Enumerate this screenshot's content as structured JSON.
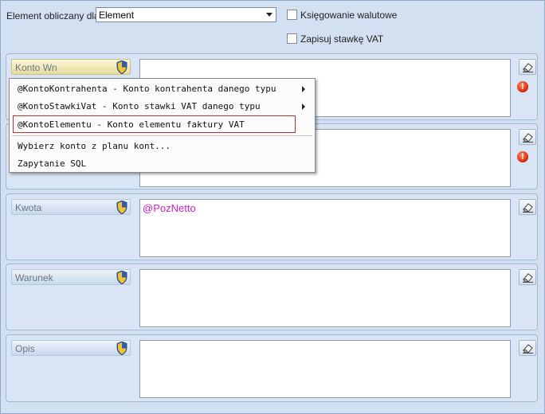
{
  "top": {
    "element_label": "Element obliczany dla:",
    "element_value": "Element",
    "checkbox_currency": "Księgowanie walutowe",
    "checkbox_vat": "Zapisuj stawkę VAT"
  },
  "sections": [
    {
      "key": "konto_wn",
      "label": "Konto Wn",
      "value": ""
    },
    {
      "key": "konto_ma",
      "label": "",
      "value": ""
    },
    {
      "key": "kwota",
      "label": "Kwota",
      "value": "@PozNetto"
    },
    {
      "key": "warunek",
      "label": "Warunek",
      "value": ""
    },
    {
      "key": "opis",
      "label": "Opis",
      "value": ""
    }
  ],
  "context_menu": {
    "items": [
      {
        "label": "@KontoKontrahenta - Konto kontrahenta danego typu",
        "submenu": true
      },
      {
        "label": "@KontoStawkiVat - Konto stawki VAT danego typu",
        "submenu": true
      },
      {
        "label": "@KontoElementu - Konto elementu faktury VAT",
        "submenu": false,
        "highlighted": true
      },
      {
        "label": "Wybierz konto z planu kont...",
        "submenu": false
      },
      {
        "label": "Zapytanie SQL",
        "submenu": false
      }
    ]
  },
  "icons": {
    "shield": "uac-shield-icon",
    "eraser": "eraser-icon",
    "warning": "error-icon",
    "dropdown": "chevron-down-icon"
  },
  "colors": {
    "background": "#d3e0f1",
    "macro_text": "#d31ecf",
    "highlight_border": "#c82c2c",
    "error": "#d42400"
  }
}
